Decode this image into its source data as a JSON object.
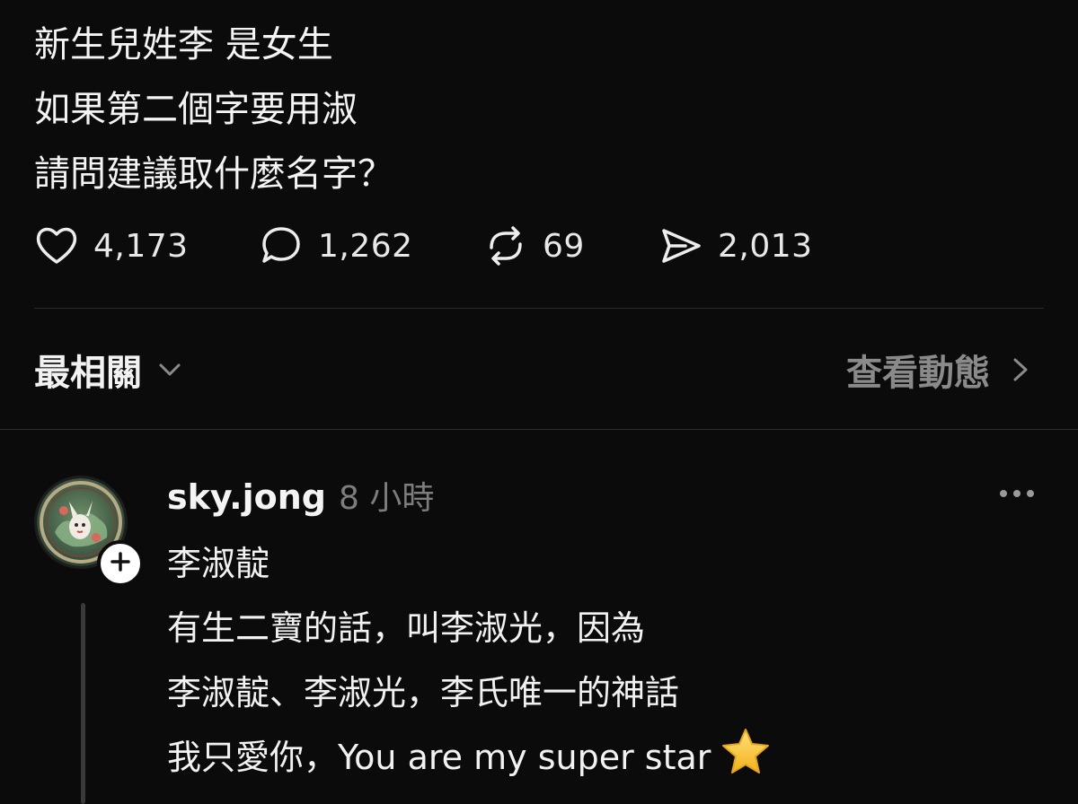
{
  "post": {
    "lines": [
      "新生兒姓李 是女生",
      "如果第二個字要用淑",
      "請問建議取什麼名字？"
    ]
  },
  "actions": {
    "like": {
      "icon": "heart-icon",
      "count": "4,173"
    },
    "comment": {
      "icon": "speech-bubble-icon",
      "count": "1,262"
    },
    "repost": {
      "icon": "repost-icon",
      "count": "69"
    },
    "share": {
      "icon": "send-icon",
      "count": "2,013"
    }
  },
  "sort": {
    "label": "最相關",
    "activity_label": "查看動態"
  },
  "comment": {
    "username": "sky.jong",
    "timestamp": "8 小時",
    "lines": [
      "李淑靛",
      "有生二寶的話，叫李淑光，因為",
      "李淑靛、李淑光，李氏唯一的神話",
      "我只愛你，You are my super star"
    ],
    "emoji": "star-icon"
  },
  "colors": {
    "background": "#0b0b0b",
    "text_primary": "#f2f2f2",
    "text_secondary": "#8a8a8a",
    "star": "#f6c73b"
  }
}
